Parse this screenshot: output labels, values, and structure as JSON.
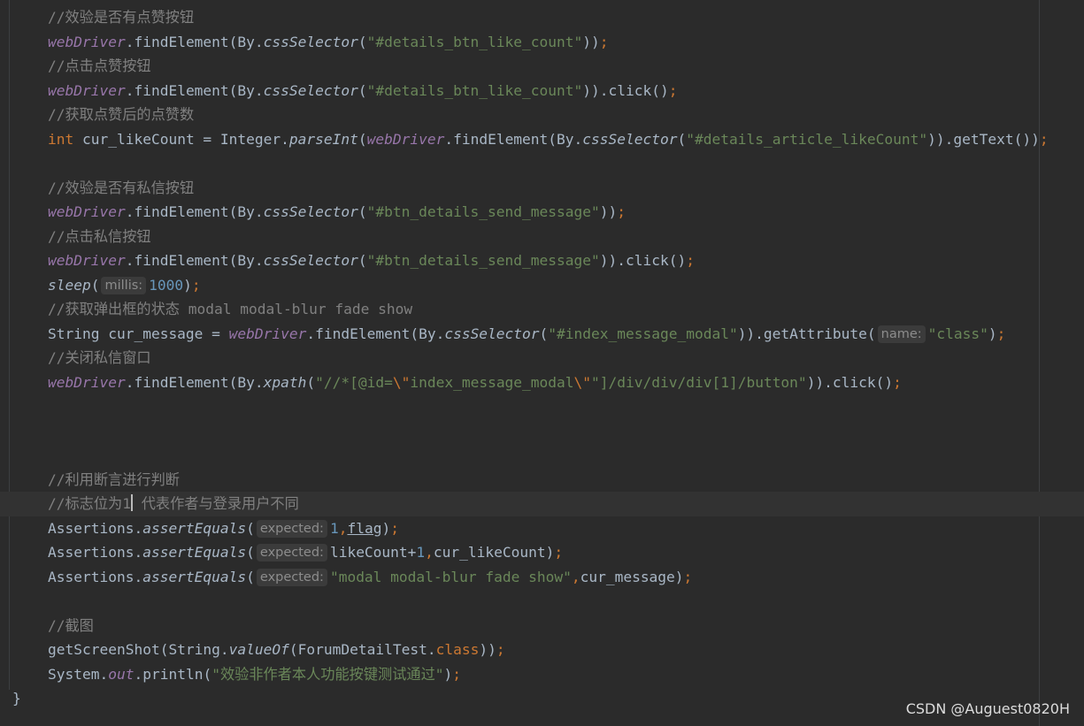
{
  "code": {
    "c1": "//效验是否有点赞按钮",
    "c2": "//点击点赞按钮",
    "c3": "//获取点赞后的点赞数",
    "c4": "//效验是否有私信按钮",
    "c5": "//点击私信按钮",
    "c6": "//获取弹出框的状态 modal modal-blur fade show",
    "c7": "//关闭私信窗口",
    "c8": "//利用断言进行判断",
    "c9a": "//标志位为1",
    "c9b": " 代表作者与登录用户不同",
    "c10": "//截图",
    "webDriver": "webDriver",
    "findElement": ".findElement(By.",
    "cssSelector": "cssSelector",
    "xpath": "xpath",
    "open_paren": "(",
    "close2": "))",
    "close_click": ")).click()",
    "semi": ";",
    "s_like": "\"#details_btn_like_count\"",
    "s_likeCount": "\"#details_article_likeCount\"",
    "s_send": "\"#btn_details_send_message\"",
    "s_modal": "\"#index_message_modal\"",
    "s_class": "\"class\"",
    "s_xpath1": "\"//*[@id=",
    "s_xpath2": "index_message_modal",
    "s_xpath3": "\"]/div/div/div[1]/button\"",
    "esc_quote": "\\\"",
    "kw_int": "int",
    "like_decl": " cur_likeCount = Integer.",
    "parseInt": "parseInt",
    "getText": ")).getText())",
    "sleep": "sleep",
    "hint_millis": "millis:",
    "num_1000": "1000",
    "close1": ")",
    "str_decl": "String cur_message = ",
    "getAttr": ")).getAttribute(",
    "hint_name": "name:",
    "assertions": "Assertions.",
    "assertEquals": "assertEquals",
    "hint_expected": "expected:",
    "num_1": "1",
    "comma": ",",
    "flag": "flag",
    "likeCount": "likeCount+",
    "cur_likeCount_arg": "cur_likeCount",
    "s_modal_class": "\"modal modal-blur fade show\"",
    "cur_message_arg": "cur_message",
    "getScreenShot": "getScreenShot(String.",
    "valueOf": "valueOf",
    "forum": "(ForumDetailTest.",
    "kw_class": "class",
    "system": "System.",
    "out": "out",
    "println": ".println(",
    "s_println": "\"效验非作者本人功能按键测试通过\"",
    "brace": "}"
  },
  "watermark": "CSDN @Auguest0820H",
  "colors": {
    "background": "#2b2b2b",
    "comment": "#808080",
    "string": "#6a8759",
    "keyword": "#cc7832",
    "number": "#6897bb",
    "field": "#9876aa"
  }
}
